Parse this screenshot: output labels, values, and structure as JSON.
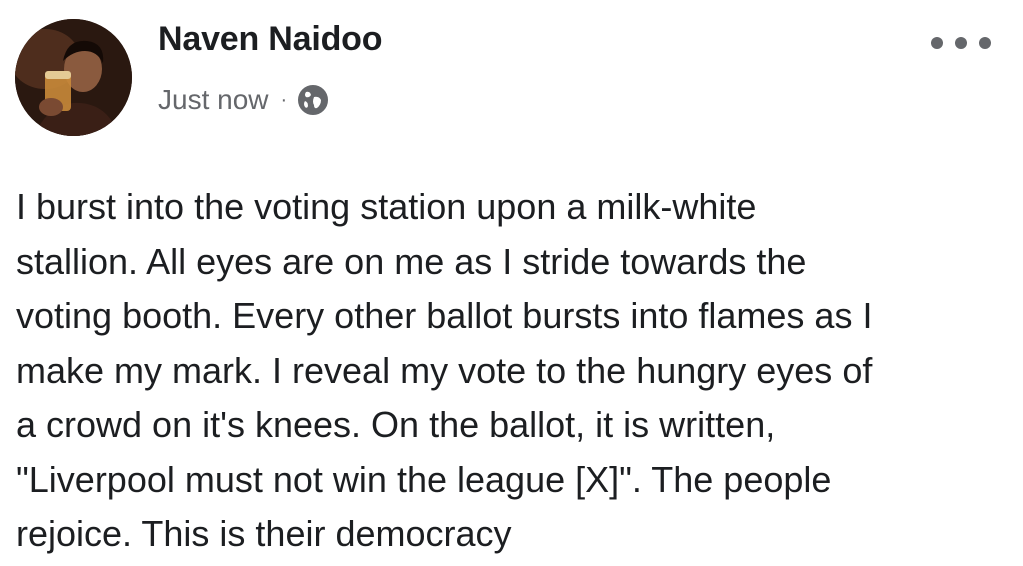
{
  "post": {
    "author": {
      "name": "Naven Naidoo",
      "avatar_icon": "profile-photo"
    },
    "meta": {
      "timestamp": "Just now",
      "separator": "·",
      "privacy_icon": "globe-icon"
    },
    "more_options_icon": "ellipsis-icon",
    "text": "I burst into the voting station upon a milk-white\nstallion. All eyes are on me as I stride towards the\nvoting booth. Every other ballot bursts into flames as I\nmake my mark. I reveal my vote to the hungry eyes of\na crowd on it's knees. On the ballot, it is written,\n\"Liverpool must not win the league [X]\". The people\nrejoice. This is their democracy"
  },
  "colors": {
    "text_primary": "#1c1e21",
    "text_secondary": "#65676b",
    "background": "#ffffff"
  }
}
